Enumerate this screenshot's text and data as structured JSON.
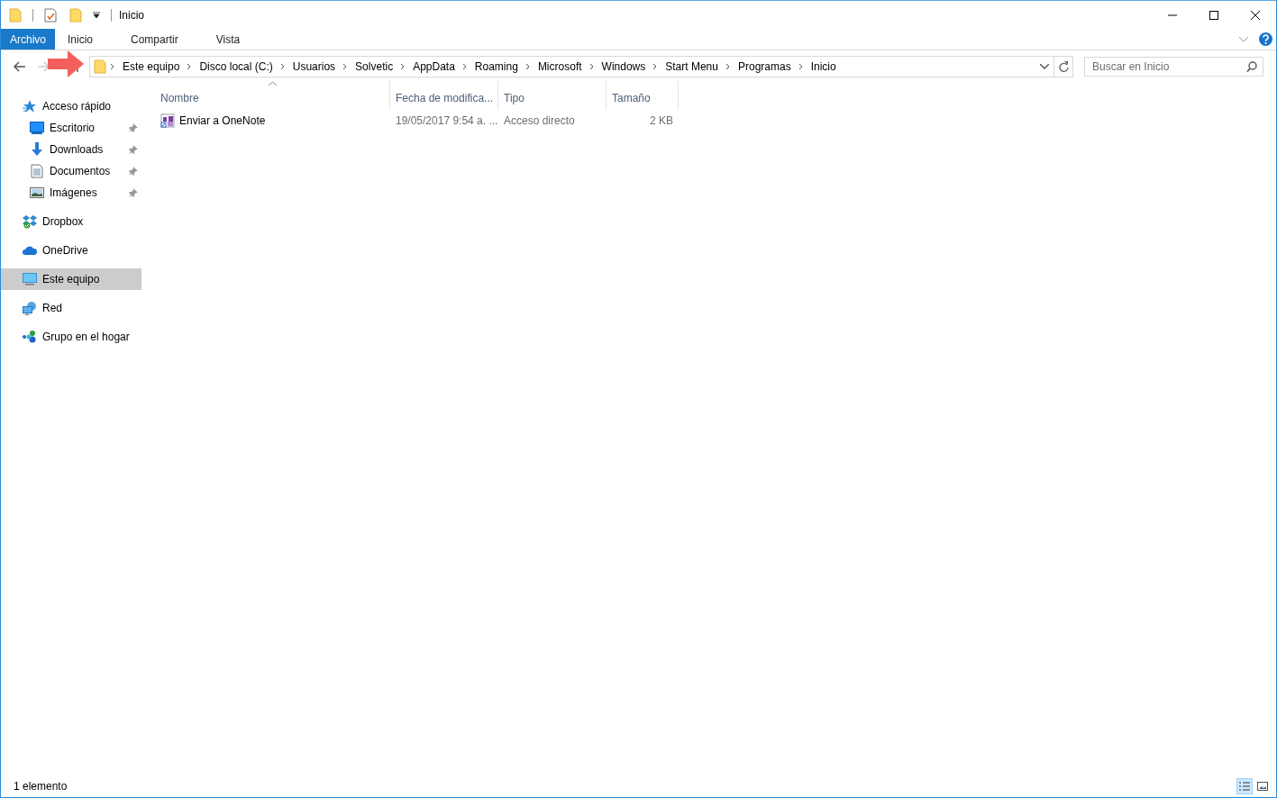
{
  "window": {
    "title": "Inicio"
  },
  "ribbon": {
    "tabs": [
      {
        "label": "Archivo",
        "kind": "file"
      },
      {
        "label": "Inicio",
        "kind": "tab"
      },
      {
        "label": "Compartir",
        "kind": "tab"
      },
      {
        "label": "Vista",
        "kind": "tab"
      }
    ]
  },
  "navigation": {
    "back_disabled": false,
    "forward_disabled": true
  },
  "address_bar": {
    "crumbs": [
      "Este equipo",
      "Disco local (C:)",
      "Usuarios",
      "Solvetic",
      "AppData",
      "Roaming",
      "Microsoft",
      "Windows",
      "Start Menu",
      "Programas",
      "Inicio"
    ]
  },
  "search": {
    "placeholder": "Buscar en Inicio"
  },
  "sidebar": {
    "items": [
      {
        "label": "Acceso rápido",
        "kind": "quick",
        "selected": false,
        "children": [
          {
            "label": "Escritorio",
            "kind": "desktop",
            "pinned": true,
            "selected": false
          },
          {
            "label": "Downloads",
            "kind": "downloads",
            "pinned": true,
            "selected": false
          },
          {
            "label": "Documentos",
            "kind": "documents",
            "pinned": true,
            "selected": false
          },
          {
            "label": "Imágenes",
            "kind": "pictures",
            "pinned": true,
            "selected": false
          }
        ]
      },
      {
        "label": "Dropbox",
        "kind": "dropbox",
        "selected": false
      },
      {
        "label": "OneDrive",
        "kind": "onedrive",
        "selected": false
      },
      {
        "label": "Este equipo",
        "kind": "computer",
        "selected": true
      },
      {
        "label": "Red",
        "kind": "network",
        "selected": false
      },
      {
        "label": "Grupo en el hogar",
        "kind": "homegroup",
        "selected": false
      }
    ]
  },
  "table": {
    "columns": [
      {
        "label": "Nombre",
        "sorted": true
      },
      {
        "label": "Fecha de modifica...",
        "sorted": false
      },
      {
        "label": "Tipo",
        "sorted": false
      },
      {
        "label": "Tamaño",
        "sorted": false
      }
    ],
    "rows": [
      {
        "cells": [
          "Enviar a OneNote",
          "19/05/2017 9:54 a. ...",
          "Acceso directo",
          "2 KB"
        ],
        "selected": false
      }
    ]
  },
  "status_bar": {
    "text": "1 elemento"
  },
  "view_buttons": [
    {
      "kind": "details",
      "selected": true
    },
    {
      "kind": "large_icons",
      "selected": false
    }
  ]
}
